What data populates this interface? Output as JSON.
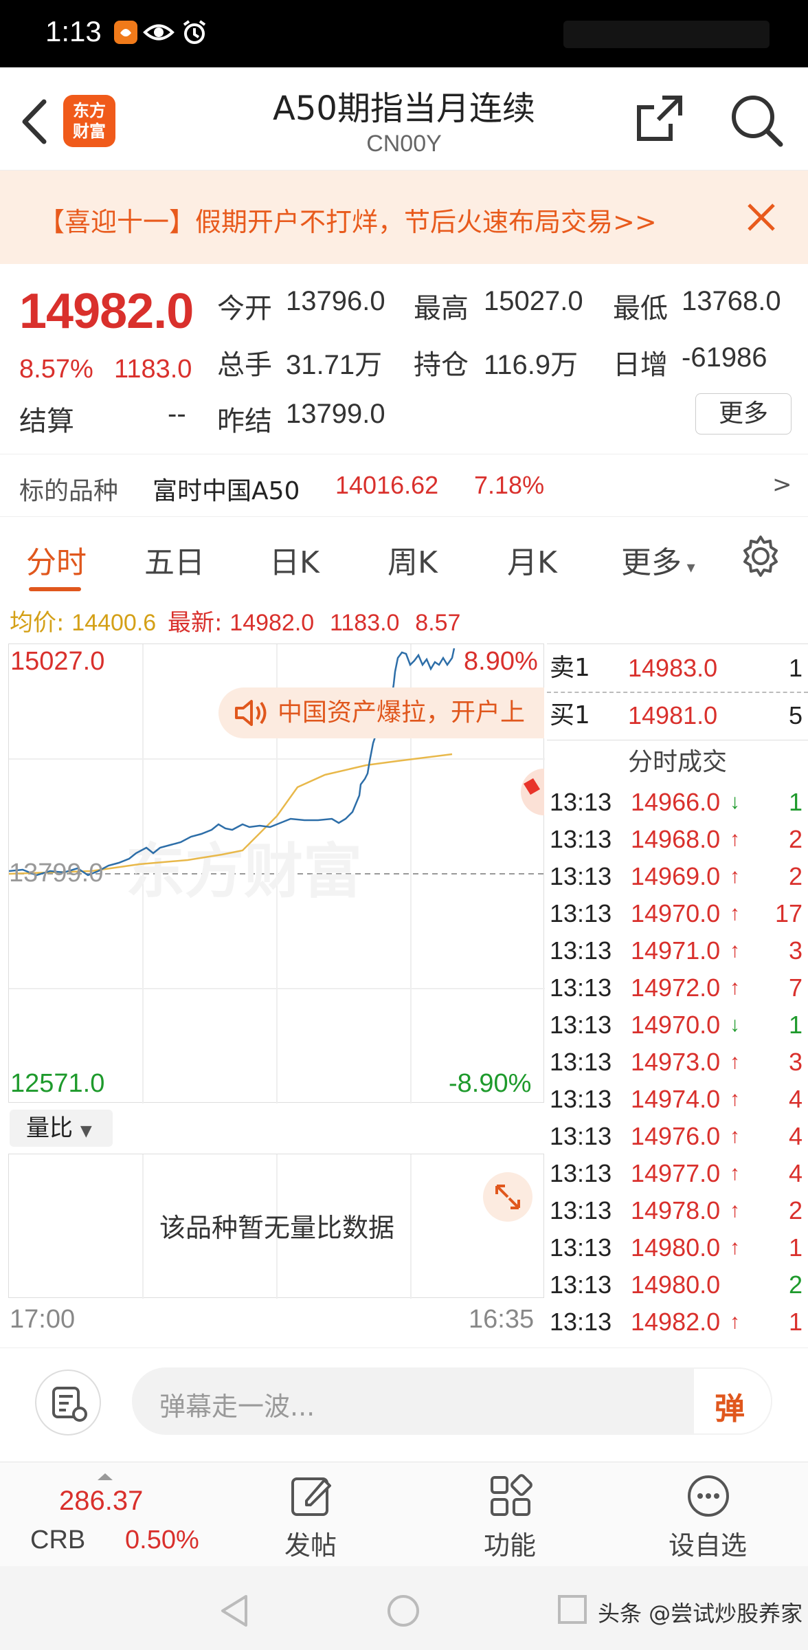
{
  "status_bar": {
    "time": "1:13",
    "icons": [
      "app-notification-icon",
      "eye-icon",
      "alarm-icon"
    ]
  },
  "header": {
    "title": "A50期指当月连续",
    "code": "CN00Y",
    "logo_text_1": "东方",
    "logo_text_2": "财富"
  },
  "banner": {
    "text": "【喜迎十一】假期开户不打烊，节后火速布局交易>>"
  },
  "quote": {
    "price": "14982.0",
    "change_pct": "8.57%",
    "change": "1183.0",
    "open_label": "今开",
    "open": "13796.0",
    "high_label": "最高",
    "high": "15027.0",
    "low_label": "最低",
    "low": "13768.0",
    "volume_label": "总手",
    "volume": "31.71万",
    "oi_label": "持仓",
    "oi": "116.9万",
    "daily_inc_label": "日增",
    "daily_inc": "-61986",
    "settle_label": "结算",
    "settle": "--",
    "prev_settle_label": "昨结",
    "prev_settle": "13799.0",
    "more_label": "更多"
  },
  "underlying": {
    "label": "标的品种",
    "name": "富时中国A50",
    "value": "14016.62",
    "pct": "7.18%",
    "arrow": ">"
  },
  "tabs": [
    "分时",
    "五日",
    "日K",
    "周K",
    "月K",
    "更多"
  ],
  "legend": {
    "avg_label": "均价:",
    "avg": "14400.6",
    "latest_label": "最新:",
    "latest": "14982.0",
    "chg": "1183.0",
    "pct": "8.57"
  },
  "chart": {
    "top_price": "15027.0",
    "top_pct": "8.90%",
    "base_price": "13799.0",
    "bottom_price": "12571.0",
    "bottom_pct": "-8.90%",
    "time_start": "17:00",
    "time_end": "16:35",
    "watermark": "东方财富",
    "popup": "中国资产爆拉，开户上",
    "colors": {
      "price_line": "#2d6ea8",
      "avg_line": "#e8b84a"
    }
  },
  "book": {
    "sell_label": "卖1",
    "sell_price": "14983.0",
    "sell_vol": "1",
    "buy_label": "买1",
    "buy_price": "14981.0",
    "buy_vol": "5",
    "trades_title": "分时成交",
    "trades": [
      {
        "time": "13:13",
        "price": "14966.0",
        "dir": "↓",
        "vol": "1",
        "up": false
      },
      {
        "time": "13:13",
        "price": "14968.0",
        "dir": "↑",
        "vol": "2",
        "up": true
      },
      {
        "time": "13:13",
        "price": "14969.0",
        "dir": "↑",
        "vol": "2",
        "up": true
      },
      {
        "time": "13:13",
        "price": "14970.0",
        "dir": "↑",
        "vol": "17",
        "up": true
      },
      {
        "time": "13:13",
        "price": "14971.0",
        "dir": "↑",
        "vol": "3",
        "up": true
      },
      {
        "time": "13:13",
        "price": "14972.0",
        "dir": "↑",
        "vol": "7",
        "up": true
      },
      {
        "time": "13:13",
        "price": "14970.0",
        "dir": "↓",
        "vol": "1",
        "up": false
      },
      {
        "time": "13:13",
        "price": "14973.0",
        "dir": "↑",
        "vol": "3",
        "up": true
      },
      {
        "time": "13:13",
        "price": "14974.0",
        "dir": "↑",
        "vol": "4",
        "up": true
      },
      {
        "time": "13:13",
        "price": "14976.0",
        "dir": "↑",
        "vol": "4",
        "up": true
      },
      {
        "time": "13:13",
        "price": "14977.0",
        "dir": "↑",
        "vol": "4",
        "up": true
      },
      {
        "time": "13:13",
        "price": "14978.0",
        "dir": "↑",
        "vol": "2",
        "up": true
      },
      {
        "time": "13:13",
        "price": "14980.0",
        "dir": "↑",
        "vol": "1",
        "up": true
      },
      {
        "time": "13:13",
        "price": "14980.0",
        "dir": "",
        "vol": "2",
        "up": null
      },
      {
        "time": "13:13",
        "price": "14982.0",
        "dir": "↑",
        "vol": "1",
        "up": true
      }
    ]
  },
  "ratio": {
    "selector": "量比",
    "no_data": "该品种暂无量比数据"
  },
  "comment": {
    "placeholder": "弹幕走一波...",
    "send": "弹"
  },
  "bottom_nav": {
    "index_value": "286.37",
    "index_name": "CRB",
    "index_pct": "0.50%",
    "post": "发帖",
    "func": "功能",
    "watch": "设自选"
  },
  "watermark_corner": "头条 @尝试炒股养家"
}
